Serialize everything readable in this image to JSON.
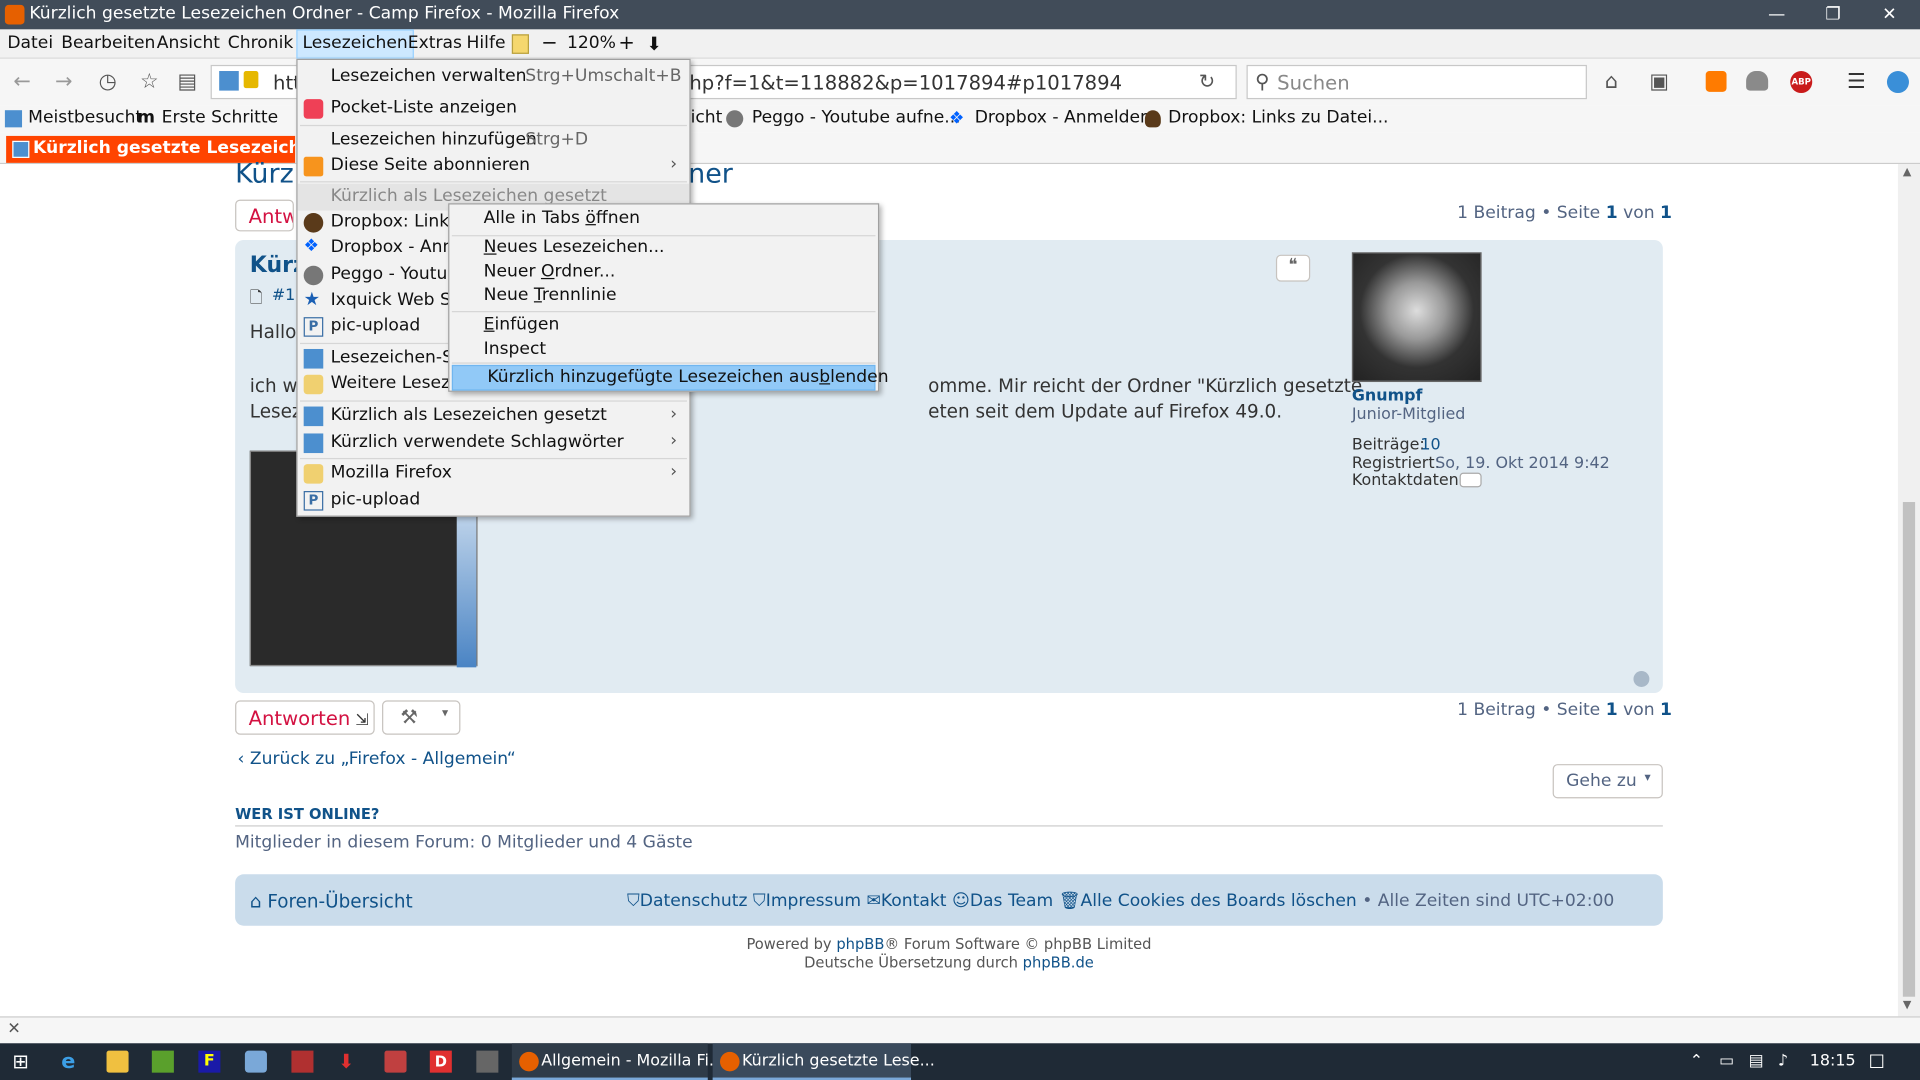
{
  "window": {
    "title": "Kürzlich gesetzte Lesezeichen Ordner - Camp Firefox - Mozilla Firefox",
    "minimize": "—",
    "restore": "❐",
    "close": "✕"
  },
  "menubar": {
    "items": [
      "Datei",
      "Bearbeiten",
      "Ansicht",
      "Chronik",
      "Lesezeichen",
      "Extras",
      "Hilfe"
    ],
    "zoom_minus": "−",
    "zoom_level": "120%",
    "zoom_plus": "+"
  },
  "navbar": {
    "url_prefix": "htt",
    "url_suffix": "hp?f=1&t=118882&p=1017894#p1017894",
    "search_placeholder": "Suchen"
  },
  "bookmarks_bar": [
    "Meistbesucht",
    "Erste Schritte",
    "icht",
    "Peggo - Youtube aufne...",
    "Dropbox - Anmelden",
    "Dropbox: Links zu Datei..."
  ],
  "tab": {
    "label": "Kürzlich gesetzte Lesezeichen ..."
  },
  "page": {
    "topic_title_left": "Kürz",
    "topic_title_right": "ner",
    "reply_btn_top": "Antw",
    "pagination": {
      "count": "1 Beitrag",
      "sep": "•",
      "page_word": "Seite",
      "page": "1",
      "of": "von",
      "total": "1"
    },
    "post": {
      "title": "Kürz",
      "num": "#1",
      "greeting": "Hallo",
      "line1_left": "ich w",
      "line1_right": "omme. Mir reicht der Ordner \"Kürzlich gesetzte",
      "line2_left": "Lesez",
      "line2_right": "eten seit dem Update auf Firefox 49.0.",
      "quote": "❝"
    },
    "author": {
      "name": "Gnumpf",
      "rank": "Junior-Mitglied",
      "posts_label": "Beiträge:",
      "posts": "10",
      "registered_label": "Registriert:",
      "registered": "So, 19. Okt 2014 9:42",
      "contact_label": "Kontaktdaten:"
    },
    "reply_btn": "Antworten",
    "back_link": "Zurück zu „Firefox - Allgemein“",
    "goto_btn": "Gehe zu",
    "online_heading": "WER IST ONLINE?",
    "online_text": "Mitglieder in diesem Forum: 0 Mitglieder und 4 Gäste",
    "footer": {
      "index": "Foren-Übersicht",
      "links": [
        "Datenschutz",
        "Impressum",
        "Kontakt",
        "Das Team",
        "Alle Cookies des Boards löschen"
      ],
      "timezone": "• Alle Zeiten sind UTC+02:00"
    },
    "powered_prefix": "Powered by",
    "powered_link": "phpBB",
    "powered_suffix": "® Forum Software © phpBB Limited",
    "translation_prefix": "Deutsche Übersetzung durch",
    "translation_link": "phpBB.de"
  },
  "bookmarks_menu": {
    "items": [
      {
        "label": "Lesezeichen verwalten",
        "shortcut": "Strg+Umschalt+B"
      },
      {
        "label": "Pocket-Liste anzeigen"
      },
      {
        "label": "Lesezeichen hinzufügen",
        "shortcut": "Strg+D"
      },
      {
        "label": "Diese Seite abonnieren"
      },
      {
        "label": "Kürzlich als Lesezeichen gesetzt"
      },
      {
        "label": "Dropbox: Links"
      },
      {
        "label": "Dropbox - Anm"
      },
      {
        "label": "Peggo - Youtub"
      },
      {
        "label": "Ixquick Web Su"
      },
      {
        "label": "pic-upload"
      },
      {
        "label": "Lesezeichen-Sy"
      },
      {
        "label": "Weitere Lesezei"
      },
      {
        "label": "Kürzlich als Lesezeichen gesetzt"
      },
      {
        "label": "Kürzlich verwendete Schlagwörter"
      },
      {
        "label": "Mozilla Firefox"
      },
      {
        "label": "pic-upload"
      }
    ]
  },
  "context_menu": {
    "items": [
      {
        "label": "Alle in Tabs ",
        "ul": "ö",
        "rest": "ffnen"
      },
      {
        "label": "",
        "ul": "N",
        "rest": "eues Lesezeichen..."
      },
      {
        "label": "Neuer ",
        "ul": "O",
        "rest": "rdner..."
      },
      {
        "label": "Neue ",
        "ul": "T",
        "rest": "rennlinie"
      },
      {
        "label": "",
        "ul": "E",
        "rest": "infügen"
      },
      {
        "label": "Inspect",
        "ul": "",
        "rest": ""
      },
      {
        "label": "Kürzlich hinzugefügte Lesezeichen aus",
        "ul": "b",
        "rest": "lenden"
      }
    ]
  },
  "taskbar": {
    "task1": "Allgemein - Mozilla Fi...",
    "task2": "Kürzlich gesetzte Lese...",
    "clock": "18:15"
  },
  "colors": {
    "titlebar": "#414c59",
    "tab": "#ff4400",
    "link": "#105289",
    "post_bg": "#e1ebf2",
    "menu_highlight": "#91c9f7",
    "taskbar": "#1f2a36"
  }
}
